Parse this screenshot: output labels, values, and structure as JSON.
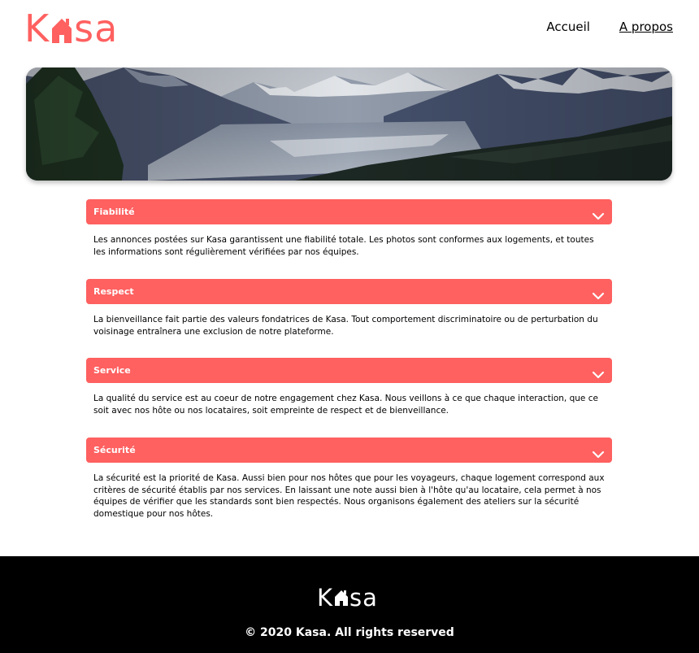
{
  "brand": {
    "logo_prefix": "K",
    "logo_suffix": "sa",
    "color": "#ff6060"
  },
  "nav": {
    "items": [
      {
        "label": "Accueil",
        "active": false
      },
      {
        "label": "A propos",
        "active": true
      }
    ]
  },
  "banner": {
    "icon": "mountain-landscape-image"
  },
  "collapses": [
    {
      "title": "Fiabilité",
      "text": "Les annonces postées sur Kasa garantissent une fiabilité totale. Les photos sont conformes aux logements, et toutes les informations sont régulièrement vérifiées par nos équipes."
    },
    {
      "title": "Respect",
      "text": "La bienveillance fait partie des valeurs fondatrices de Kasa. Tout comportement discriminatoire ou de perturbation du voisinage entraînera une exclusion de notre plateforme."
    },
    {
      "title": "Service",
      "text": "La qualité du service est au coeur de notre engagement chez Kasa. Nous veillons à ce que chaque interaction, que ce soit avec nos hôte ou nos locataires, soit empreinte de respect et de bienveillance."
    },
    {
      "title": "Sécurité",
      "text": "La sécurité est la priorité de Kasa. Aussi bien pour nos hôtes que pour les voyageurs, chaque logement correspond aux critères de sécurité établis par nos services. En laissant une note aussi bien à l'hôte qu'au locataire, cela permet à nos équipes de vérifier que les standards sont bien respectés. Nous organisons également des ateliers sur la sécurité domestique pour nos hôtes."
    }
  ],
  "footer": {
    "copyright": "© 2020 Kasa. All rights reserved"
  }
}
